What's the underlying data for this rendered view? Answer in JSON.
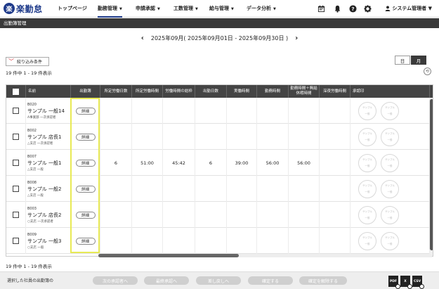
{
  "app": {
    "logo_mark": "楽",
    "logo_text": "楽勤怠"
  },
  "nav": {
    "items": [
      {
        "label": "トップページ",
        "caret": ""
      },
      {
        "label": "勤務管理",
        "caret": "▼"
      },
      {
        "label": "申請承認",
        "caret": "▼"
      },
      {
        "label": "工数管理",
        "caret": "▼"
      },
      {
        "label": "給与管理",
        "caret": "▼"
      },
      {
        "label": "データ分析",
        "caret": "▼"
      }
    ],
    "user": "システム管理者 ▼"
  },
  "page_title": "出勤簿管理",
  "period": {
    "prev": "‹",
    "label": "2025年09月( 2025年09月01日 - 2025年09月30日 )",
    "next": "›"
  },
  "filter": {
    "chevron": "﹀",
    "label": "絞り込み条件"
  },
  "view_toggle": {
    "day": "日",
    "month": "月"
  },
  "settings_glyph": "⟲",
  "count_top": "19 件中 1 - 19 件表示",
  "count_bottom": "19 件中 1 - 19 件表示",
  "table": {
    "headers": [
      "名前",
      "出勤簿",
      "所定労働日数",
      "所定労働時間",
      "労働時間の総枠",
      "出勤日数",
      "実働時間",
      "勤務時間",
      "勤務時間＋無給休暇時間",
      "深夜労働時間",
      "承認印"
    ],
    "detail_label": "詳細",
    "stamp_text": [
      "サンプル",
      "一般",
      "　"
    ],
    "rows": [
      {
        "code": "B020",
        "name": "サンプル 一般14",
        "org": "A事業部 一次承認者",
        "cells": [
          "",
          "",
          "",
          "",
          "",
          "",
          "",
          ""
        ]
      },
      {
        "code": "B002",
        "name": "サンプル 店長1",
        "org": "△支店 一次承認者",
        "cells": [
          "",
          "",
          "",
          "",
          "",
          "",
          "",
          ""
        ]
      },
      {
        "code": "B007",
        "name": "サンプル 一般1",
        "org": "△支店 一般",
        "cells": [
          "6",
          "51:00",
          "45:42",
          "6",
          "39:00",
          "56:00",
          "56:00",
          ""
        ]
      },
      {
        "code": "B008",
        "name": "サンプル 一般2",
        "org": "△支店 一般",
        "cells": [
          "",
          "",
          "",
          "",
          "",
          "",
          "",
          ""
        ]
      },
      {
        "code": "B003",
        "name": "サンプル 店長2",
        "org": "○支店 一次承認者",
        "cells": [
          "",
          "",
          "",
          "",
          "",
          "",
          "",
          ""
        ]
      },
      {
        "code": "B009",
        "name": "サンプル 一般3",
        "org": "○支店 一般",
        "cells": [
          "",
          "",
          "",
          "",
          "",
          "",
          "",
          ""
        ]
      }
    ]
  },
  "bottom": {
    "label": "選択した社員の出勤簿の",
    "buttons": [
      "次の承認者へ",
      "最終承認へ",
      "差し戻しへ",
      "確定する",
      "確定を解除する"
    ],
    "files": [
      "PDF",
      "X",
      "CSV"
    ]
  }
}
